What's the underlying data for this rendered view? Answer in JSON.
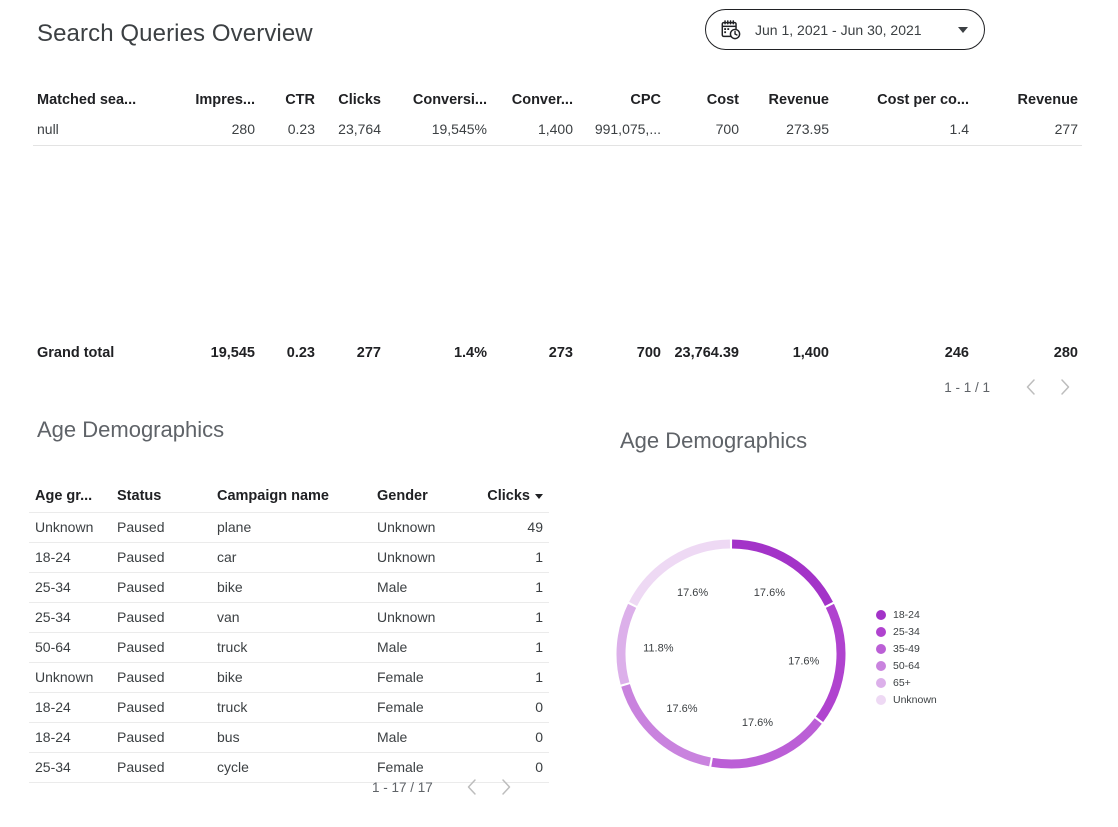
{
  "header": {
    "title": "Search Queries Overview",
    "date_range": {
      "icon": "calendar-clock-icon",
      "value": "Jun 1, 2021 - Jun 30, 2021",
      "caret": "chevron-down-icon"
    }
  },
  "search_queries_table": {
    "columns": [
      "Matched sea...",
      "Impres...",
      "CTR",
      "Clicks",
      "Conversi...",
      "Conver...",
      "CPC",
      "Cost",
      "Revenue",
      "Cost per co...",
      "Revenue"
    ],
    "rows": [
      [
        "null",
        "280",
        "0.23",
        "23,764",
        "19,545%",
        "1,400",
        "991,075,...",
        "700",
        "273.95",
        "1.4",
        "277"
      ]
    ],
    "grand_total": [
      "Grand total",
      "19,545",
      "0.23",
      "277",
      "1.4%",
      "273",
      "700",
      "23,764.39",
      "1,400",
      "246",
      "280"
    ],
    "pagination": {
      "label": "1 - 1 / 1",
      "prev": "chevron-left-icon",
      "next": "chevron-right-icon"
    }
  },
  "age_demographics_table": {
    "title": "Age Demographics",
    "columns": [
      "Age gr...",
      "Status",
      "Campaign name",
      "Gender",
      "Clicks"
    ],
    "sorted_column": "Clicks",
    "rows": [
      [
        "Unknown",
        "Paused",
        "plane",
        "Unknown",
        "49"
      ],
      [
        "18-24",
        "Paused",
        "car",
        "Unknown",
        "1"
      ],
      [
        "25-34",
        "Paused",
        "bike",
        "Male",
        "1"
      ],
      [
        "25-34",
        "Paused",
        "van",
        "Unknown",
        "1"
      ],
      [
        "50-64",
        "Paused",
        "truck",
        "Male",
        "1"
      ],
      [
        "Unknown",
        "Paused",
        "bike",
        "Female",
        "1"
      ],
      [
        "18-24",
        "Paused",
        "truck",
        "Female",
        "0"
      ],
      [
        "18-24",
        "Paused",
        "bus",
        "Male",
        "0"
      ],
      [
        "25-34",
        "Paused",
        "cycle",
        "Female",
        "0"
      ]
    ],
    "pagination": {
      "label": "1 - 17 / 17",
      "prev": "chevron-left-icon",
      "next": "chevron-right-icon"
    }
  },
  "chart_data": {
    "type": "pie",
    "variant": "donut",
    "title": "Age Demographics",
    "categories": [
      "18-24",
      "25-34",
      "35-49",
      "50-64",
      "65+",
      "Unknown"
    ],
    "values": [
      17.6,
      17.6,
      17.6,
      17.6,
      11.8,
      17.6
    ],
    "labels": [
      "17.6%",
      "17.6%",
      "17.6%",
      "17.6%",
      "11.8%",
      "17.6%"
    ],
    "colors": [
      "#a333c8",
      "#b043cf",
      "#bb5fd6",
      "#c983de",
      "#dcb0ea",
      "#eed9f4"
    ],
    "legend_position": "right",
    "start_angle": 0,
    "grid": false
  }
}
